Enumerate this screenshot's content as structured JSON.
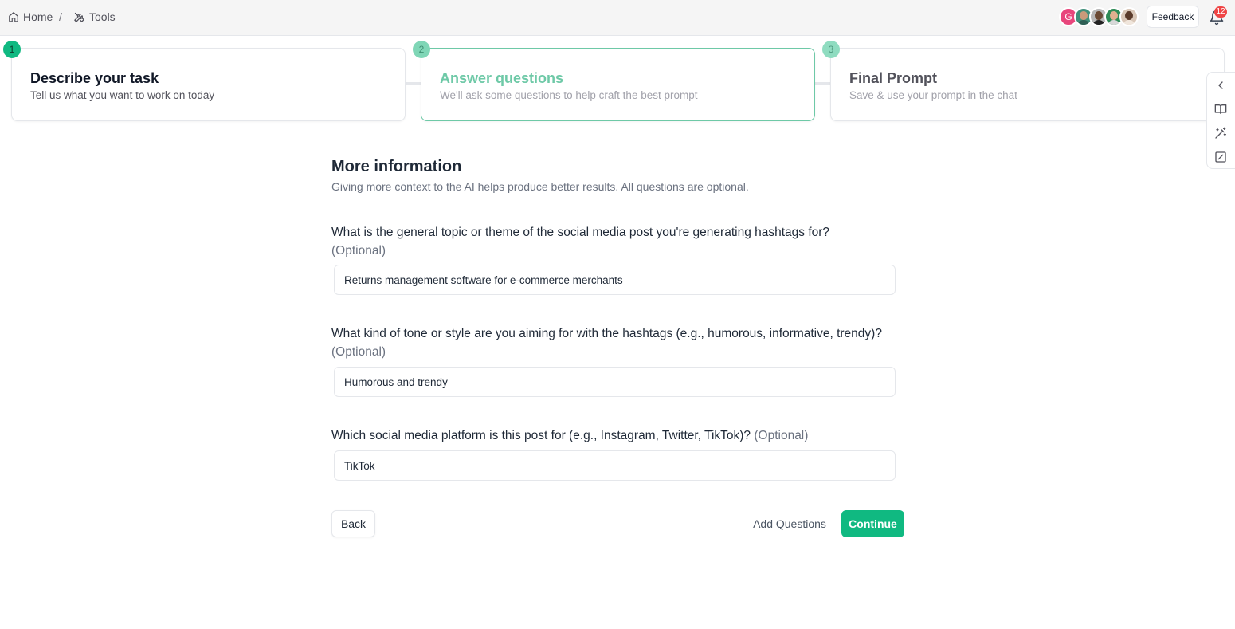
{
  "breadcrumb": {
    "home_label": "Home",
    "separator": "/",
    "tools_label": "Tools"
  },
  "header": {
    "avatars": [
      {
        "initial": "G",
        "color": "#e8467c"
      },
      {
        "initial": "",
        "color": "#3f8f7a"
      },
      {
        "initial": "",
        "color": "#b8b8b8"
      },
      {
        "initial": "",
        "color": "#2e8b57"
      },
      {
        "initial": "",
        "color": "#d9c7b8"
      }
    ],
    "feedback_label": "Feedback",
    "notification_count": "12"
  },
  "steps": [
    {
      "number": "1",
      "title": "Describe your task",
      "subtitle": "Tell us what you want to work on today",
      "state": "completed"
    },
    {
      "number": "2",
      "title": "Answer questions",
      "subtitle": "We'll ask some questions to help craft the best prompt",
      "state": "active"
    },
    {
      "number": "3",
      "title": "Final Prompt",
      "subtitle": "Save & use your prompt in the chat",
      "state": "upcoming"
    }
  ],
  "main": {
    "title": "More information",
    "subtitle": "Giving more context to the AI helps produce better results. All questions are optional.",
    "questions": [
      {
        "label": "What is the general topic or theme of the social media post you're generating hashtags for?",
        "optional": "(Optional)",
        "value": "Returns management software for e-commerce merchants"
      },
      {
        "label": "What kind of tone or style are you aiming for with the hashtags (e.g., humorous, informative, trendy)?",
        "optional": "(Optional)",
        "value": "Humorous and trendy"
      },
      {
        "label": "Which social media platform is this post for (e.g., Instagram, Twitter, TikTok)?",
        "optional": "(Optional)",
        "value": "TikTok"
      }
    ],
    "back_label": "Back",
    "add_questions_label": "Add Questions",
    "continue_label": "Continue"
  },
  "colors": {
    "accent": "#10b981",
    "accent_light": "#6ec9a7",
    "badge": "#ef4444"
  }
}
